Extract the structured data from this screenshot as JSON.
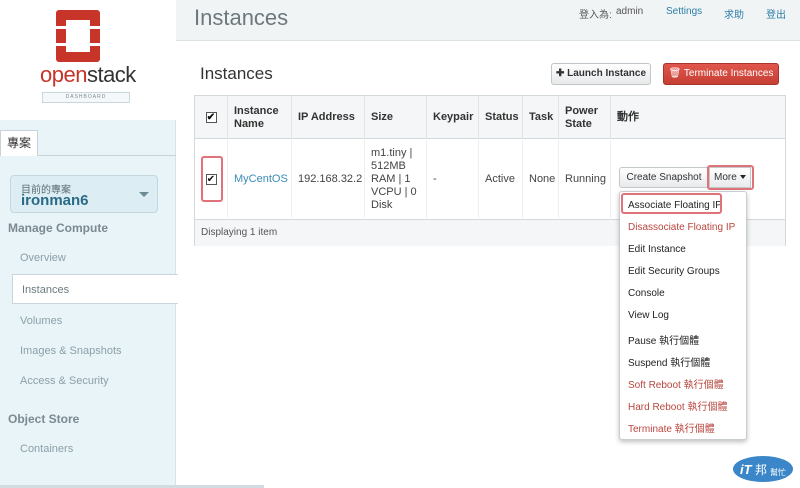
{
  "brand": {
    "name_left": "open",
    "name_right": "stack",
    "sub": "DASHBOARD",
    "accent": "#c6342a"
  },
  "sidebar": {
    "tab_label": "專案",
    "project_caption": "目前的專案",
    "project_name": "ironman6",
    "sections": [
      {
        "title": "Manage Compute",
        "items": [
          "Overview",
          "Instances",
          "Volumes",
          "Images & Snapshots",
          "Access & Security"
        ]
      },
      {
        "title": "Object Store",
        "items": [
          "Containers"
        ]
      }
    ],
    "active_item": "Instances"
  },
  "header": {
    "title": "Instances",
    "logged_in_label": "登入為:",
    "username": "admin",
    "settings": "Settings",
    "help": "求助",
    "logout": "登出"
  },
  "main": {
    "title": "Instances",
    "launch_button": "Launch Instance",
    "terminate_button": "Terminate Instances",
    "columns": [
      "Instance Name",
      "IP Address",
      "Size",
      "Keypair",
      "Status",
      "Task",
      "Power State",
      "動作"
    ],
    "row": {
      "name": "MyCentOS",
      "ip": "192.168.32.2",
      "size_lines": [
        "m1.tiny |",
        "512MB",
        "RAM | 1",
        "VCPU | 0",
        "Disk"
      ],
      "keypair": "-",
      "status": "Active",
      "task": "None",
      "power": "Running",
      "snapshot_button": "Create Snapshot",
      "more_button": "More"
    },
    "footer": "Displaying 1 item",
    "dropdown": [
      "Associate Floating IP",
      "Disassociate Floating IP",
      "Edit Instance",
      "Edit Security Groups",
      "Console",
      "View Log",
      "Pause 執行個體",
      "Suspend 執行個體",
      "Soft Reboot 執行個體",
      "Hard Reboot 執行個體",
      "Terminate 執行個體"
    ]
  },
  "watermark": {
    "left": "iT",
    "right": "邦",
    "sub": "幫忙"
  }
}
